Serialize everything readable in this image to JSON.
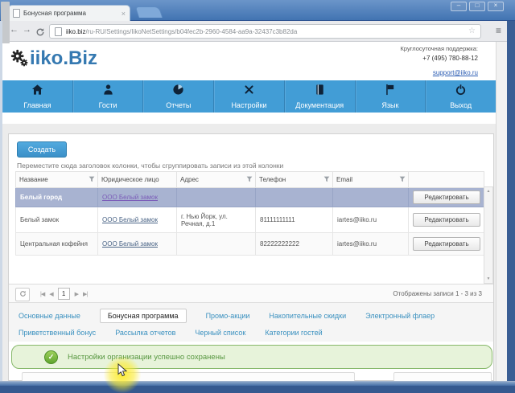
{
  "window": {
    "tab_title": "Бонусная программа",
    "url_host": "iiko.biz",
    "url_path": "/ru-RU/Settings/IikoNetSettings/b04fec2b-2960-4584-aa9a-32437c3b82da"
  },
  "icons": {
    "minimize": "–",
    "maximize": "□",
    "close": "×",
    "tab_close": "×",
    "back": "←",
    "forward": "→",
    "star": "☆",
    "menu": "≡",
    "up": "▲",
    "down": "▼",
    "first": "|◀",
    "prev": "◀",
    "next": "▶",
    "last": "▶|",
    "check": "✓"
  },
  "header": {
    "logo": "iiko.Biz",
    "support_label": "Круглосуточная поддержка:",
    "support_phone": "+7 (495) 780-88-12",
    "support_email": "support@iiko.ru"
  },
  "nav": {
    "items": [
      {
        "label": "Главная",
        "icon": "home-icon"
      },
      {
        "label": "Гости",
        "icon": "user-icon"
      },
      {
        "label": "Отчеты",
        "icon": "pie-chart-icon"
      },
      {
        "label": "Настройки",
        "icon": "tools-icon"
      },
      {
        "label": "Документация",
        "icon": "book-icon"
      },
      {
        "label": "Язык",
        "icon": "flag-icon"
      },
      {
        "label": "Выход",
        "icon": "power-icon"
      }
    ]
  },
  "content": {
    "create_button": "Создать",
    "group_hint": "Переместите сюда заголовок колонки, чтобы сгруппировать записи из этой колонки",
    "table": {
      "columns": [
        "Название",
        "Юридическое лицо",
        "Адрес",
        "Телефон",
        "Email"
      ],
      "edit_button": "Редактировать",
      "rows": [
        {
          "name": "Белый город",
          "legal": "ООО Белый замок",
          "address": "",
          "phone": "",
          "email": "",
          "selected": true
        },
        {
          "name": "Белый замок",
          "legal": "ООО Белый замок",
          "address": "г. Нью Йорк, ул. Речная, д.1",
          "phone": "81111111111",
          "email": "iartes@iiko.ru",
          "selected": false
        },
        {
          "name": "Центральная кофейня",
          "legal": "ООО Белый замок",
          "address": "",
          "phone": "82222222222",
          "email": "iartes@iiko.ru",
          "selected": false
        }
      ]
    },
    "pagination": {
      "page": "1",
      "records_info": "Отображены записи 1 - 3 из 3"
    },
    "tabs": [
      {
        "label": "Основные данные",
        "active": false
      },
      {
        "label": "Бонусная программа",
        "active": true
      },
      {
        "label": "Промо-акции",
        "active": false
      },
      {
        "label": "Накопительные скидки",
        "active": false
      },
      {
        "label": "Электронный флаер",
        "active": false
      },
      {
        "label": "Приветственный бонус",
        "active": false
      },
      {
        "label": "Рассылка отчетов",
        "active": false
      },
      {
        "label": "Черный список",
        "active": false
      },
      {
        "label": "Категории гостей",
        "active": false
      }
    ],
    "success_message": "Настройки организации успешно сохранены"
  },
  "colors": {
    "nav_blue": "#429dd6",
    "logo_blue": "#3579b1",
    "link_blue": "#3990bf",
    "selected_row": "#a8b3d1",
    "success_bg": "#e7f3da",
    "success_border": "#86b86a",
    "success_text": "#56963f",
    "titlebar_blue": "#4274b2"
  }
}
